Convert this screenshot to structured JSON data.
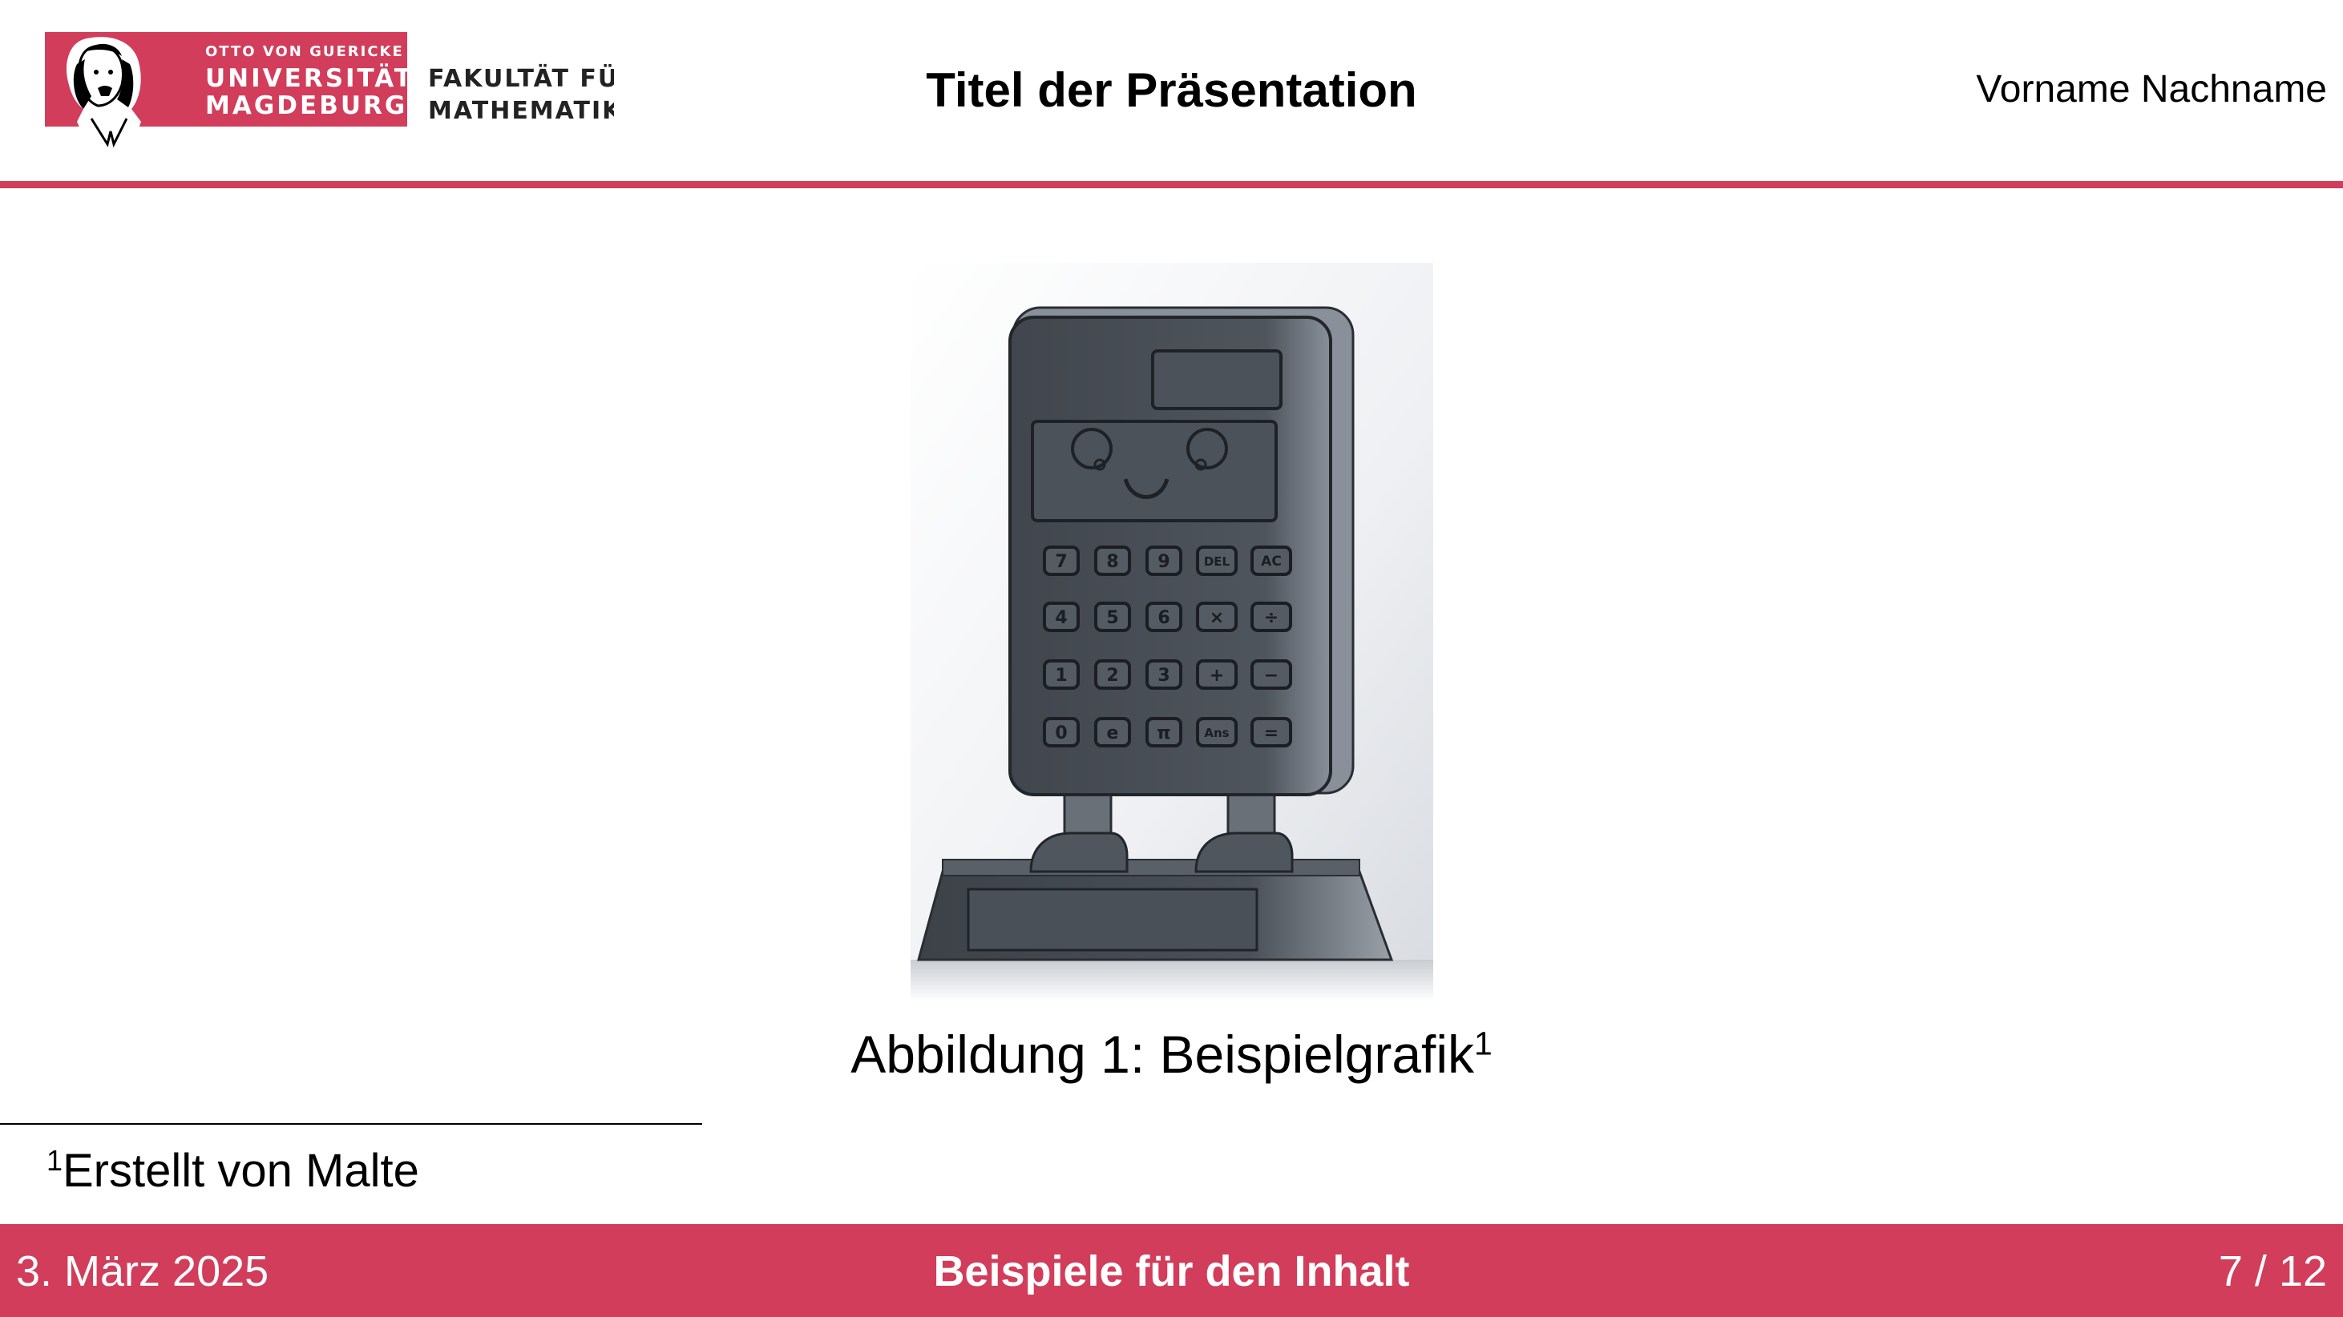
{
  "header": {
    "logo": {
      "line1": "OTTO VON GUERICKE",
      "line2": "UNIVERSITÄT",
      "line3": "MAGDEBURG",
      "faculty_line1": "FAKULTÄT FÜR",
      "faculty_line2": "MATHEMATIK"
    },
    "title": "Titel der Präsentation",
    "author": "Vorname Nachname"
  },
  "figure": {
    "caption_text": "Abbildung 1: Beispielgrafik",
    "caption_marker": "1",
    "calculator_keys": [
      "7",
      "8",
      "9",
      "DEL",
      "AC",
      "4",
      "5",
      "6",
      "×",
      "÷",
      "1",
      "2",
      "3",
      "+",
      "−",
      "0",
      "e",
      "π",
      "Ans",
      "="
    ]
  },
  "footnote": {
    "marker": "1",
    "text": "Erstellt von Malte"
  },
  "footer": {
    "date": "3. März 2025",
    "section": "Beispiele für den Inhalt",
    "page": "7 / 12"
  },
  "colors": {
    "accent": "#d13d5a",
    "calculator_body": "#4a5058"
  }
}
